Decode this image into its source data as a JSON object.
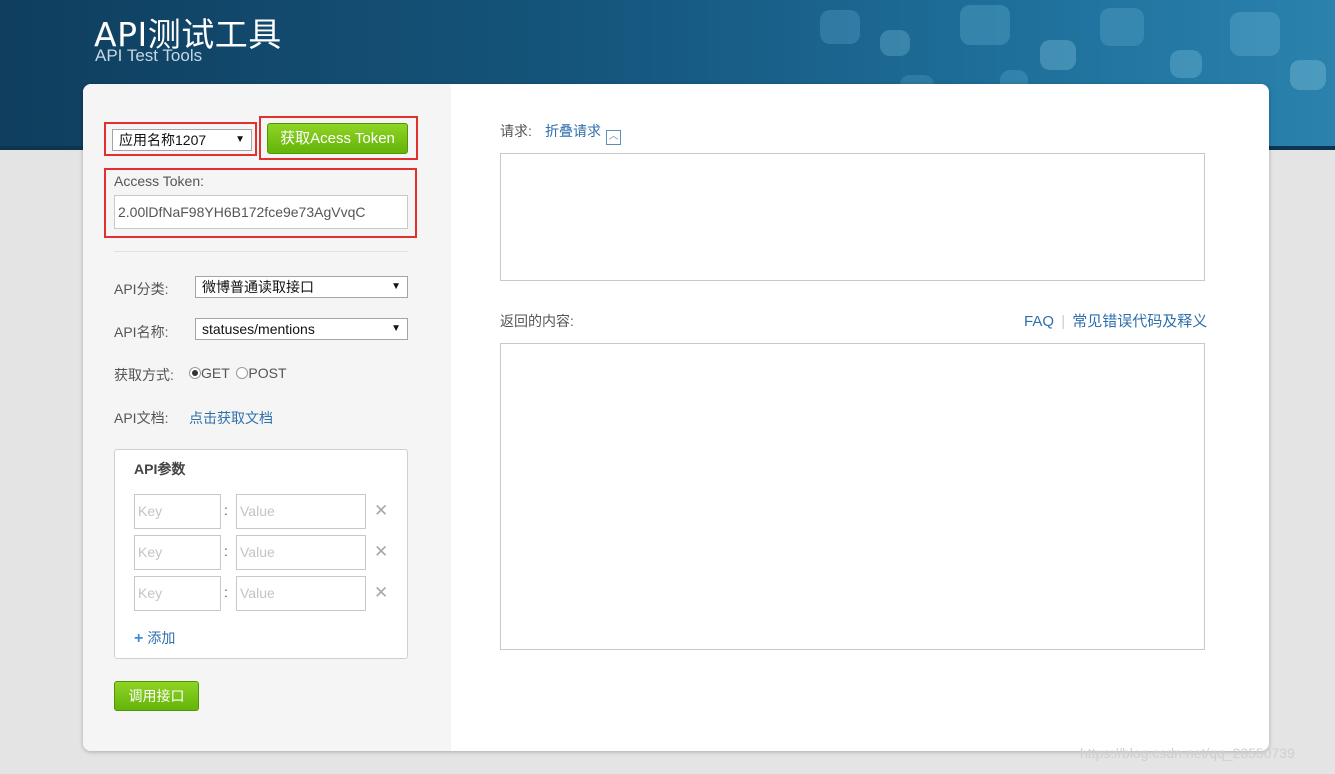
{
  "header": {
    "title": "API测试工具",
    "subtitle": "API Test Tools"
  },
  "app_select": {
    "value": "应用名称1207"
  },
  "get_token_button": "获取Acess Token",
  "access_token": {
    "label": "Access Token:",
    "value": "2.00lDfNaF98YH6B172fce9e73AgVvqC"
  },
  "api_category": {
    "label": "API分类:",
    "value": "微博普通读取接口"
  },
  "api_name": {
    "label": "API名称:",
    "value": "statuses/mentions"
  },
  "method": {
    "label": "获取方式:",
    "options": [
      "GET",
      "POST"
    ],
    "selected": "GET"
  },
  "api_doc": {
    "label": "API文档:",
    "link": "点击获取文档"
  },
  "params": {
    "title": "API参数",
    "key_placeholder": "Key",
    "value_placeholder": "Value",
    "rows": 3,
    "add_label": "添加"
  },
  "call_button": "调用接口",
  "request": {
    "label": "请求:",
    "fold_link": "折叠请求"
  },
  "response": {
    "label": "返回的内容:",
    "faq": "FAQ",
    "separator": "|",
    "errors_link": "常见错误代码及释义"
  },
  "watermark": "https://blog.csdn.net/qq_28550739"
}
